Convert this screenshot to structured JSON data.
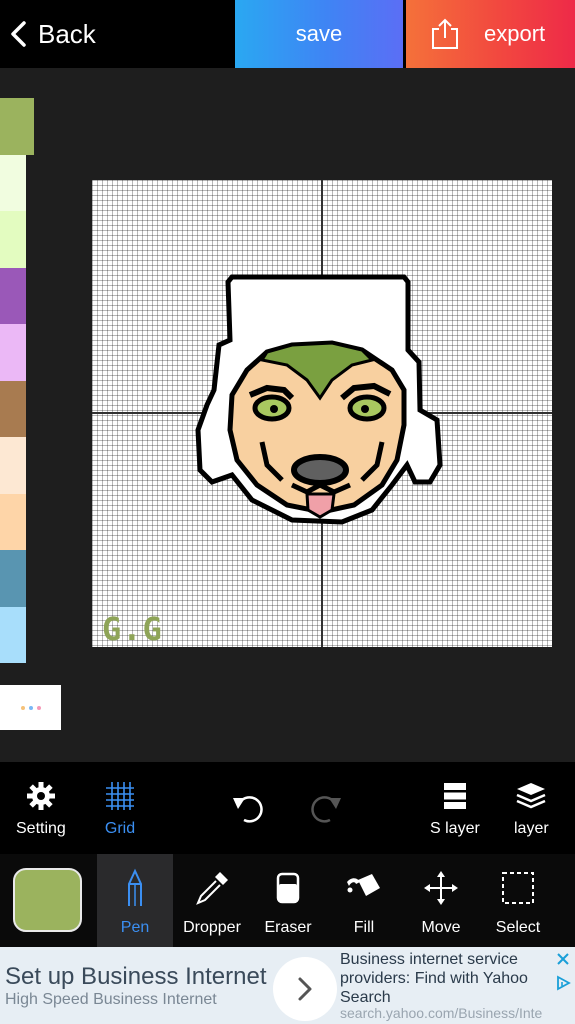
{
  "topbar": {
    "back_label": "Back",
    "save_label": "save",
    "export_label": "export",
    "back_icon": "chevron-left-icon",
    "export_icon": "share-icon"
  },
  "palette": {
    "colors": [
      "#9bb35e",
      "#f1fde0",
      "#e3fcc0",
      "#9a58b8",
      "#ebb8f6",
      "#a87b50",
      "#fde8d3",
      "#fed5a8",
      "#5995b1",
      "#a8defb"
    ],
    "selected_index": 0,
    "more_icon": "more-dots-icon",
    "more_dot_colors": [
      "#f5c27a",
      "#7ab8f5",
      "#f59ab8"
    ]
  },
  "canvas": {
    "grid": true,
    "signature_text": "G.G",
    "signature_color": "#8ea457",
    "skin_color": "#f8d0a0",
    "hair_color": "#7aa040",
    "eye_color": "#a8c860",
    "outline_color": "#000000",
    "nose_color": "#606060",
    "tongue_color": "#f0a0a8"
  },
  "toolbar1": {
    "setting_label": "Setting",
    "grid_label": "Grid",
    "slayer_label": "S layer",
    "layer_label": "layer",
    "icons": [
      "gear-icon",
      "grid-icon",
      "undo-icon",
      "redo-icon",
      "slayer-icon",
      "layers-icon"
    ]
  },
  "toolbar2": {
    "current_color": "#9bb35e",
    "pen_label": "Pen",
    "dropper_label": "Dropper",
    "eraser_label": "Eraser",
    "fill_label": "Fill",
    "move_label": "Move",
    "select_label": "Select",
    "active_tool": "Pen",
    "accent": "#3b8ff2"
  },
  "ad": {
    "headline": "Set up Business Internet",
    "subline": "High Speed Business Internet",
    "description": "Business internet service providers: Find with Yahoo Search",
    "url": "search.yahoo.com/Business/Inte"
  }
}
